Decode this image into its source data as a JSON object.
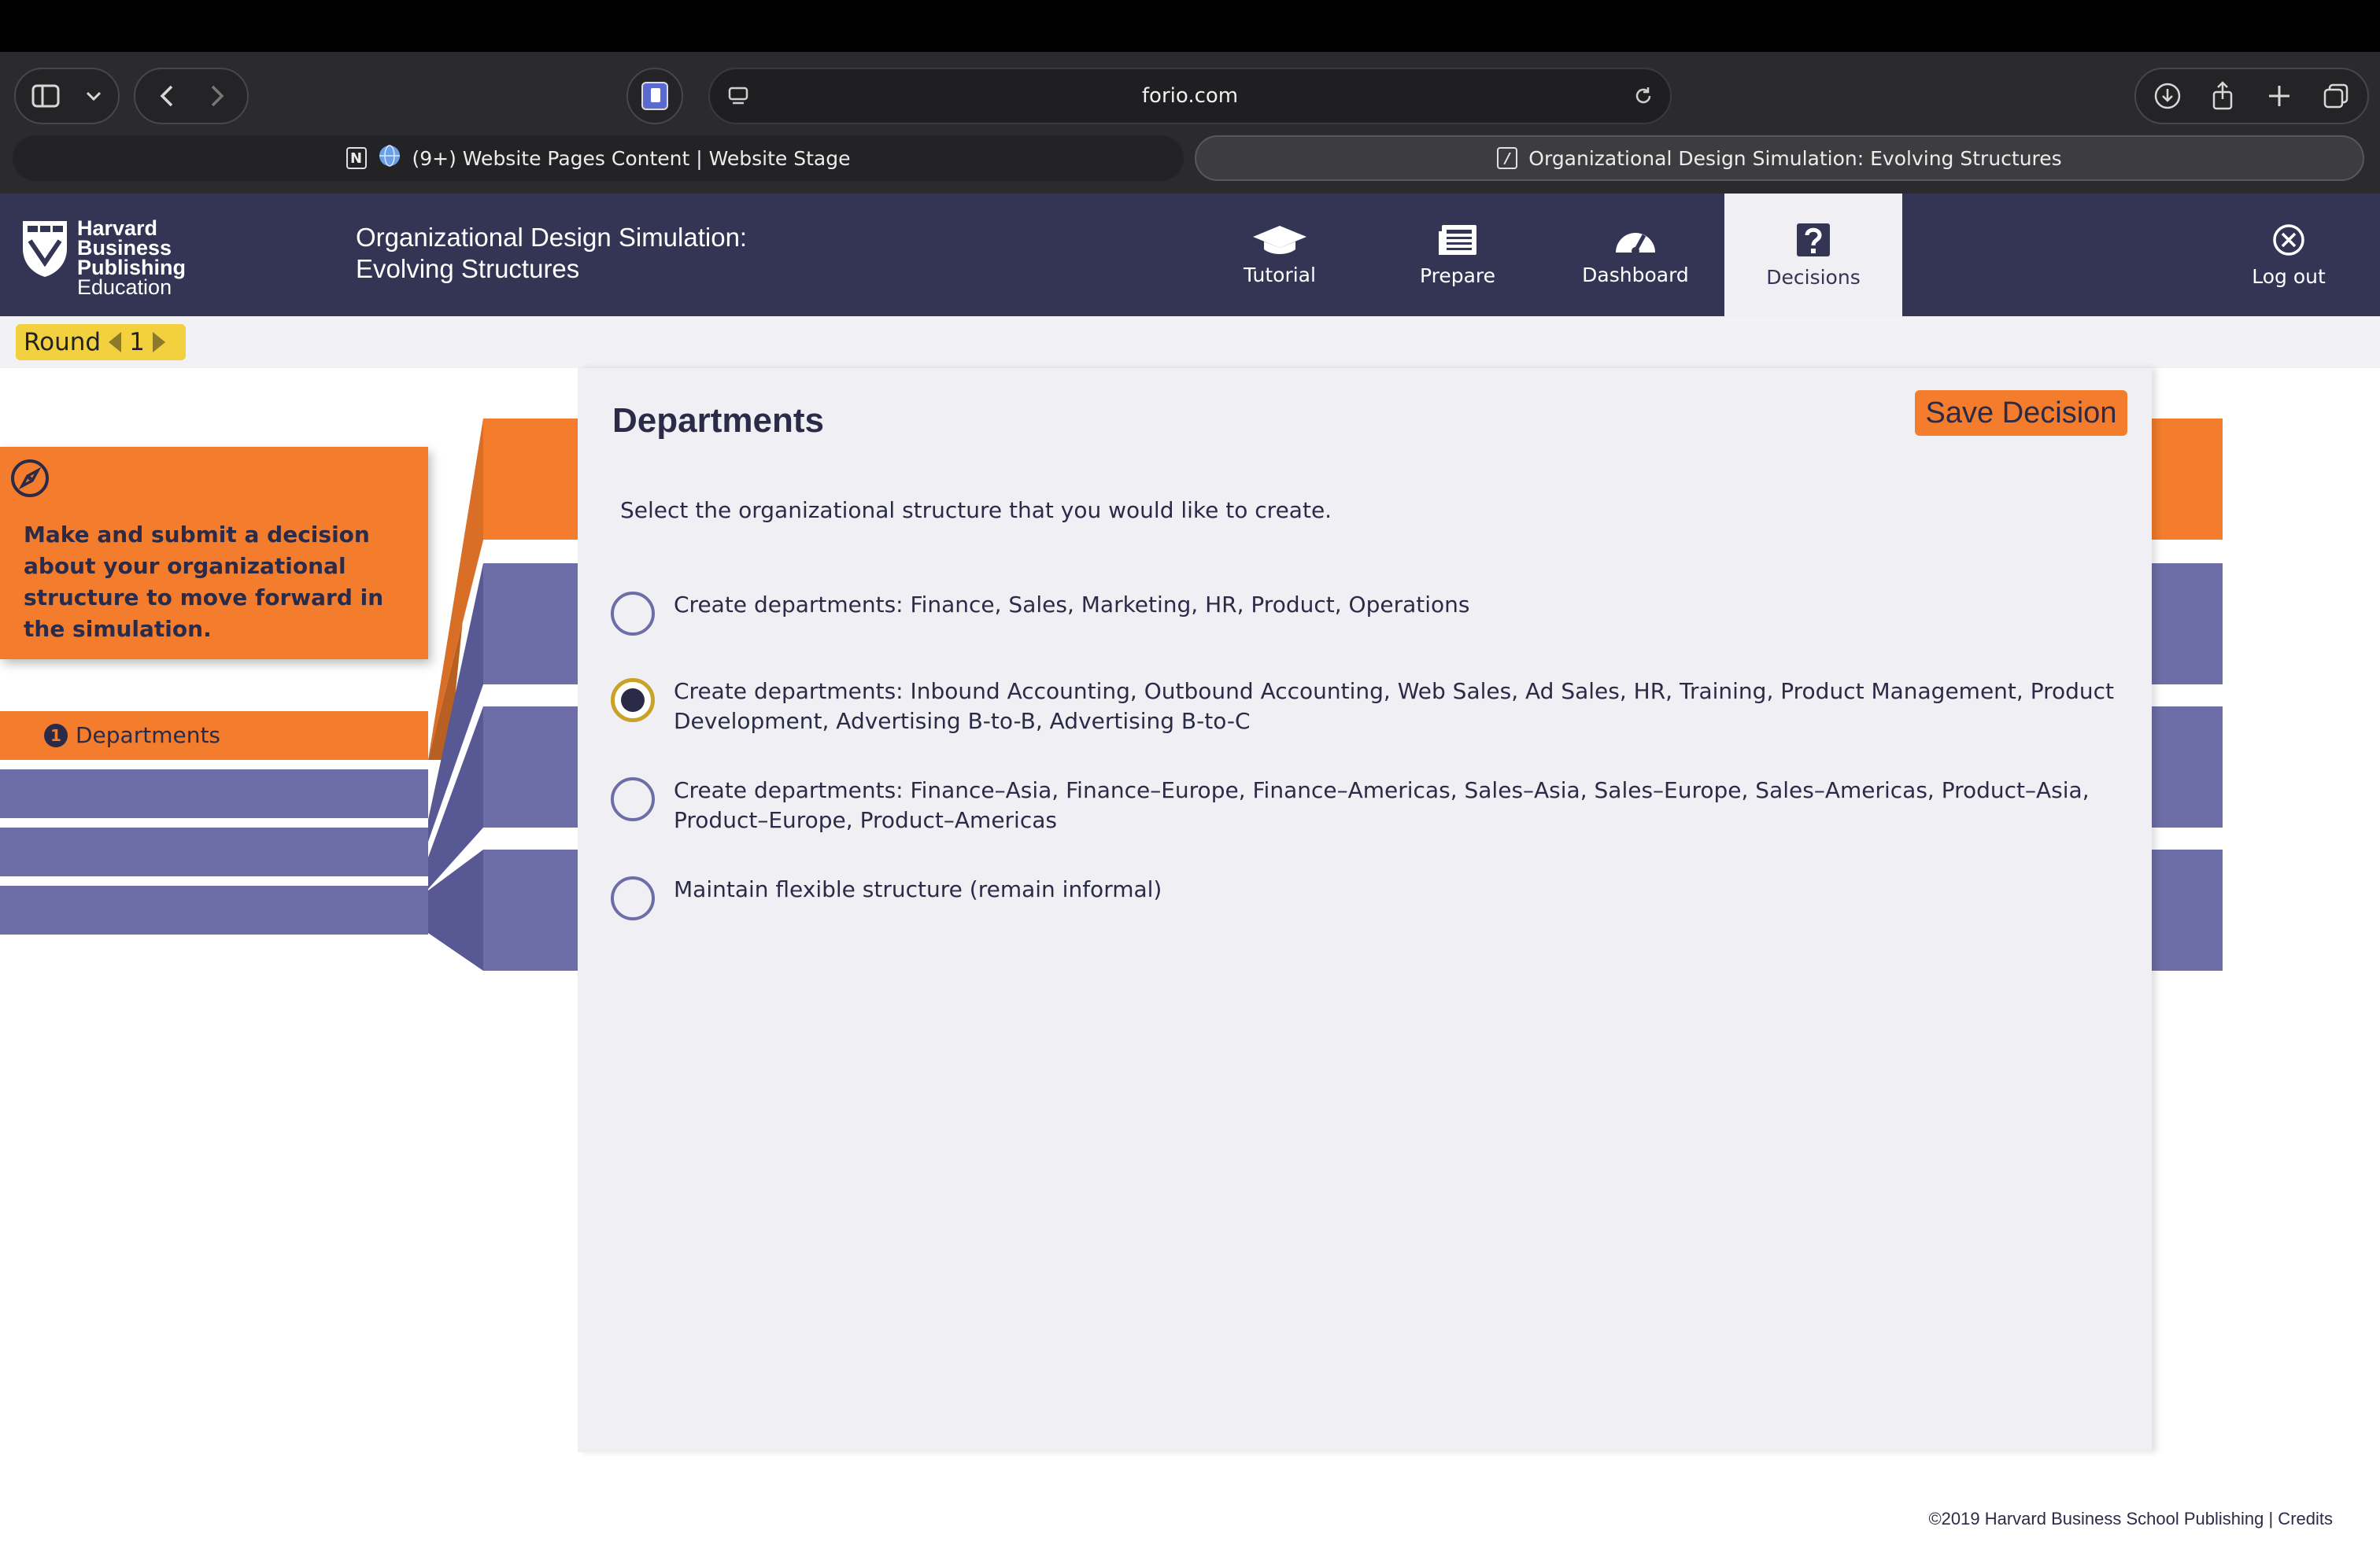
{
  "browser": {
    "url": "forio.com",
    "tabs": [
      {
        "label": "(9+) Website Pages Content | Website Stage",
        "active": false
      },
      {
        "label": "Organizational Design Simulation: Evolving Structures",
        "active": true
      }
    ]
  },
  "header": {
    "logo_lines": [
      "Harvard",
      "Business",
      "Publishing",
      "Education"
    ],
    "title_line1": "Organizational Design Simulation:",
    "title_line2": "Evolving Structures",
    "nav": [
      {
        "label": "Tutorial",
        "icon": "graduation-cap-icon"
      },
      {
        "label": "Prepare",
        "icon": "newspaper-icon"
      },
      {
        "label": "Dashboard",
        "icon": "speedometer-icon"
      },
      {
        "label": "Decisions",
        "icon": "question-icon",
        "active": true
      },
      {
        "label": "Log out",
        "icon": "close-circle-icon"
      }
    ]
  },
  "round": {
    "label": "Round",
    "value": "1"
  },
  "sidebar": {
    "tip": "Make and submit a decision about your organizational structure to move forward in the simulation.",
    "step_number": "1",
    "step_label": "Departments"
  },
  "main": {
    "title": "Departments",
    "save_label": "Save Decision",
    "instruction": "Select the organizational structure that you would like to create.",
    "options": [
      {
        "label": "Create departments: Finance, Sales, Marketing, HR, Product, Operations",
        "selected": false
      },
      {
        "label": "Create departments: Inbound Accounting, Outbound Accounting, Web Sales, Ad Sales, HR, Training, Product Management, Product Development, Advertising B-to-B, Advertising B-to-C",
        "selected": true
      },
      {
        "label": "Create departments: Finance–Asia, Finance–Europe, Finance–Americas, Sales–Asia, Sales–Europe, Sales–Americas, Product–Asia, Product–Europe, Product–Americas",
        "selected": false
      },
      {
        "label": "Maintain flexible structure (remain informal)",
        "selected": false
      }
    ]
  },
  "footer": {
    "text": "©2019 Harvard Business School Publishing | Credits"
  },
  "colors": {
    "header": "#343455",
    "accent": "#f47c2d",
    "purple": "#6d6ea8",
    "round": "#f3d03e"
  }
}
